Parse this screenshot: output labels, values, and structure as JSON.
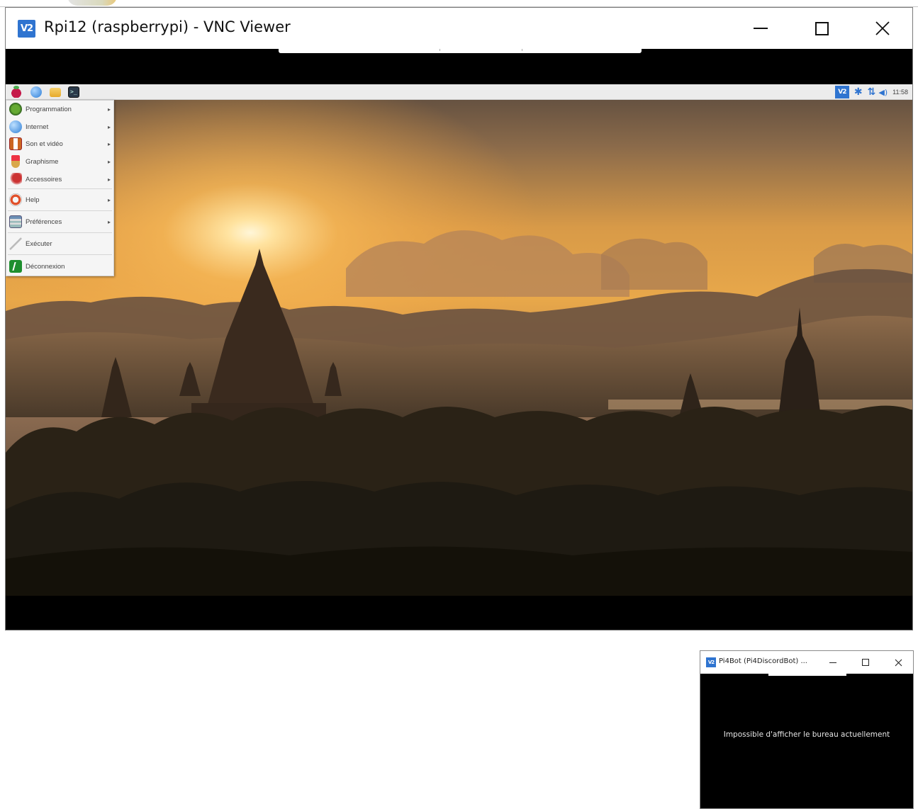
{
  "main_window": {
    "logo_text": "V2",
    "title": "Rpi12 (raspberrypi) - VNC Viewer"
  },
  "remote_desktop": {
    "tray": {
      "vnc_text": "V2",
      "bluetooth_glyph": "✱",
      "network_glyph": "⇅",
      "volume_glyph": "◀)",
      "clock": "11:58"
    },
    "menu": {
      "items": [
        {
          "label": "Programmation",
          "icon": "programming-icon",
          "has_submenu": true
        },
        {
          "label": "Internet",
          "icon": "internet-icon",
          "has_submenu": true
        },
        {
          "label": "Son et vidéo",
          "icon": "sound-video-icon",
          "has_submenu": true
        },
        {
          "label": "Graphisme",
          "icon": "graphics-icon",
          "has_submenu": true
        },
        {
          "label": "Accessoires",
          "icon": "accessories-icon",
          "has_submenu": true
        },
        {
          "label": "Help",
          "icon": "help-icon",
          "has_submenu": true
        },
        {
          "label": "Préférences",
          "icon": "preferences-icon",
          "has_submenu": true
        },
        {
          "label": "Exécuter",
          "icon": "run-icon",
          "has_submenu": false
        },
        {
          "label": "Déconnexion",
          "icon": "logout-icon",
          "has_submenu": false
        }
      ],
      "submenu_arrow": "▸"
    }
  },
  "second_window": {
    "logo_text": "V2",
    "title": "Pi4Bot (Pi4DiscordBot) ...",
    "message": "Impossible d'afficher le bureau actuellement"
  },
  "colors": {
    "vnc_blue": "#2f74d0",
    "panel_bg": "#ececec",
    "menu_bg": "#f5f5f5"
  }
}
